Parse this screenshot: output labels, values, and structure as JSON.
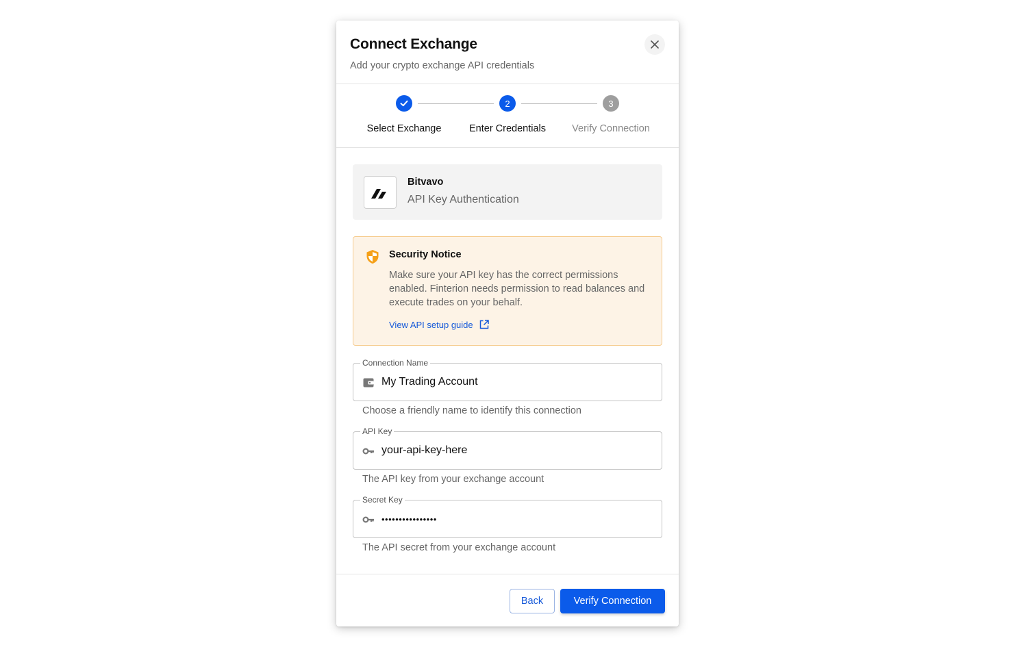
{
  "dialog": {
    "title": "Connect Exchange",
    "subtitle": "Add your crypto exchange API credentials"
  },
  "stepper": {
    "steps": [
      {
        "label": "Select Exchange",
        "number": "1",
        "state": "completed"
      },
      {
        "label": "Enter Credentials",
        "number": "2",
        "state": "active"
      },
      {
        "label": "Verify Connection",
        "number": "3",
        "state": "pending"
      }
    ]
  },
  "exchange": {
    "name": "Bitvavo",
    "auth_method": "API Key Authentication"
  },
  "notice": {
    "title": "Security Notice",
    "text": "Make sure your API key has the correct permissions enabled. Finterion needs permission to read balances and execute trades on your behalf.",
    "link_label": "View API setup guide"
  },
  "form": {
    "connection_name": {
      "label": "Connection Name",
      "value": "My Trading Account",
      "helper": "Choose a friendly name to identify this connection"
    },
    "api_key": {
      "label": "API Key",
      "value": "your-api-key-here",
      "helper": "The API key from your exchange account"
    },
    "secret_key": {
      "label": "Secret Key",
      "value": "••••••••••••••••",
      "helper": "The API secret from your exchange account"
    }
  },
  "footer": {
    "back_label": "Back",
    "verify_label": "Verify Connection"
  },
  "colors": {
    "primary": "#0b5bea",
    "link": "#1659d9",
    "step_pending": "#9e9e9e",
    "notice_bg": "#fdf3e6",
    "notice_border": "#f6cc8f",
    "shield": "#f5a018"
  },
  "icons": {
    "close": "close-icon",
    "completed_step": "check-icon",
    "exchange_logo": "bitvavo-logo",
    "notice": "shield-icon",
    "external": "external-link-icon",
    "connection_name": "wallet-icon",
    "api_key": "key-icon",
    "secret_key": "key-icon"
  }
}
